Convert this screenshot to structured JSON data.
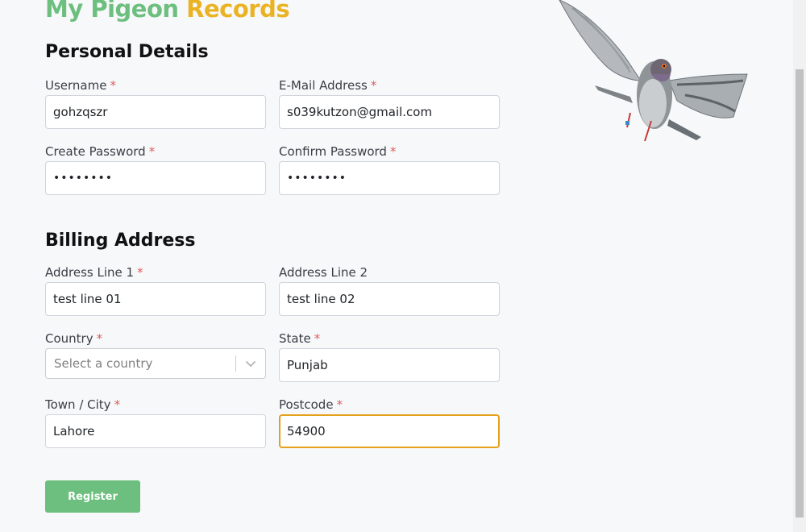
{
  "brand": {
    "word1": "My Pigeon",
    "word2": "Records"
  },
  "personal": {
    "title": "Personal Details",
    "username": {
      "label": "Username",
      "required": "*",
      "value": "gohzqszr"
    },
    "email": {
      "label": "E-Mail Address",
      "required": "*",
      "value": "s039kutzon@gmail.com"
    },
    "password": {
      "label": "Create Password",
      "required": "*",
      "value": "••••••••"
    },
    "confirm": {
      "label": "Confirm Password",
      "required": "*",
      "value": "••••••••"
    }
  },
  "billing": {
    "title": "Billing Address",
    "line1": {
      "label": "Address Line 1",
      "required": "*",
      "value": "test line 01"
    },
    "line2": {
      "label": "Address Line 2",
      "value": "test line 02"
    },
    "country": {
      "label": "Country",
      "required": "*",
      "placeholder": "Select a country"
    },
    "state": {
      "label": "State",
      "required": "*",
      "value": "Punjab"
    },
    "city": {
      "label": "Town / City",
      "required": "*",
      "value": "Lahore"
    },
    "postcode": {
      "label": "Postcode",
      "required": "*",
      "value": "54900"
    }
  },
  "actions": {
    "register": "Register"
  },
  "icons": {
    "dropdown": "chevron-down-icon",
    "image": "pigeon-illustration"
  },
  "colors": {
    "brand_green": "#6cbf7e",
    "brand_yellow": "#eab324",
    "focus_border": "#e4a11b",
    "required": "#e05b5b"
  }
}
